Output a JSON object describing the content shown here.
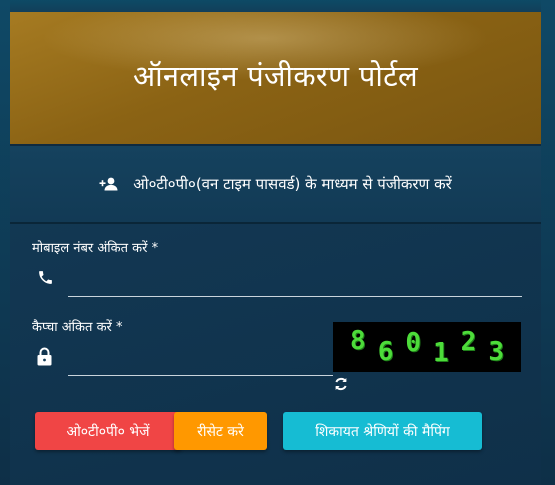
{
  "header": {
    "title": "ऑनलाइन पंजीकरण पोर्टल"
  },
  "subtitle": {
    "icon": "add-user-icon",
    "text": "ओ०टी०पी०(वन टाइम पासवर्ड) के माध्यम से पंजीकरण करें"
  },
  "form": {
    "mobile": {
      "label": "मोबाइल नंबर अंकित करें *",
      "icon": "phone-icon",
      "value": ""
    },
    "captcha_field": {
      "label": "कैप्चा अंकित करें *",
      "icon": "lock-icon",
      "value": ""
    },
    "captcha_image": {
      "digits": [
        "8",
        "6",
        "0",
        "1",
        "2",
        "3"
      ],
      "refresh_icon": "refresh-icon"
    }
  },
  "buttons": {
    "send_otp": "ओ०टी०पी० भेजें",
    "reset": "रीसेट करे",
    "mapping": "शिकायत श्रेणियों की मैपिंग"
  },
  "colors": {
    "header_bg": "#8b6314",
    "panel_bg": "#143650",
    "btn_otp": "#f04545",
    "btn_reset": "#ff9800",
    "btn_mapping": "#16bcd3",
    "captcha_text": "#4ddc3a"
  }
}
